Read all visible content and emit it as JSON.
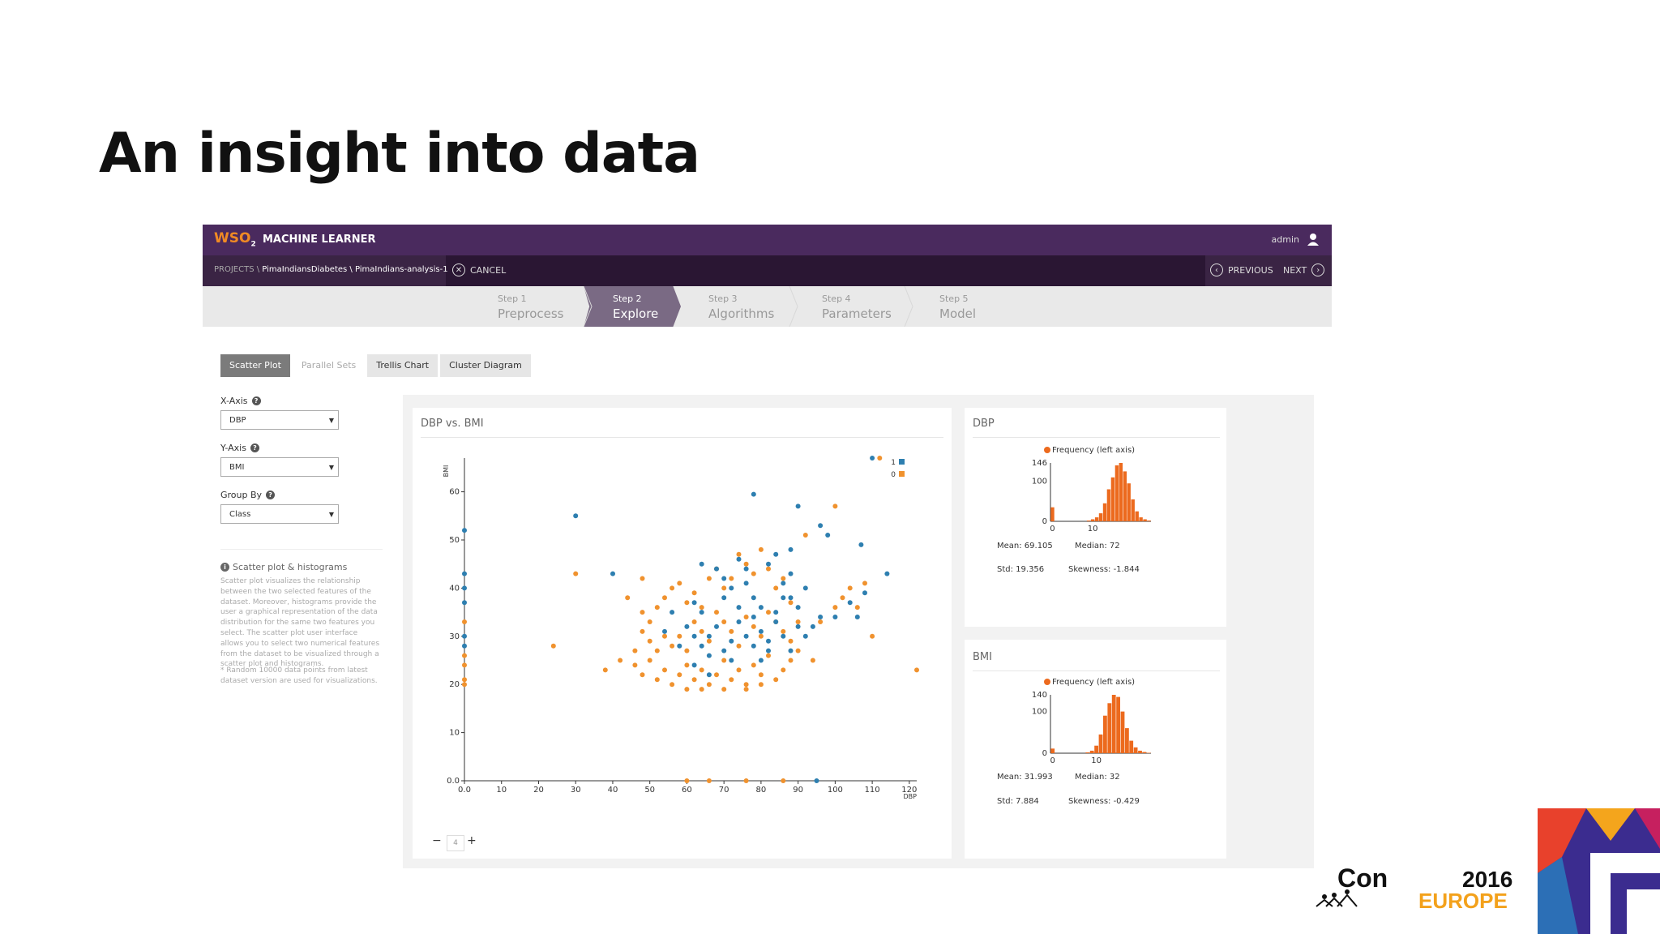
{
  "slide": {
    "title": "An insight into data"
  },
  "app": {
    "logo_text": "WSO",
    "logo_sub": "2",
    "name": "MACHINE LEARNER",
    "user": "admin",
    "breadcrumb_prefix": "PROJECTS \\ ",
    "breadcrumb_path": "PimaIndiansDiabetes \\ PimaIndians-analysis-1",
    "cancel": "CANCEL",
    "previous": "PREVIOUS",
    "next": "NEXT",
    "steps": [
      {
        "num": "Step 1",
        "label": "Preprocess"
      },
      {
        "num": "Step 2",
        "label": "Explore"
      },
      {
        "num": "Step 3",
        "label": "Algorithms"
      },
      {
        "num": "Step 4",
        "label": "Parameters"
      },
      {
        "num": "Step 5",
        "label": "Model"
      }
    ],
    "active_step": 1,
    "tabs": [
      "Scatter Plot",
      "Parallel Sets",
      "Trellis Chart",
      "Cluster Diagram"
    ],
    "x_axis_label": "X-Axis",
    "x_axis_value": "DBP",
    "y_axis_label": "Y-Axis",
    "y_axis_value": "BMI",
    "group_by_label": "Group By",
    "group_by_value": "Class",
    "info_title": "Scatter plot & histograms",
    "info_body": "Scatter plot visualizes the relationship between the two selected features of the dataset. Moreover, histograms provide the user a graphical representation of the data distribution for the same two features you select. The scatter plot user interface allows you to select two numerical features from the dataset to be visualized through a scatter plot and histograms.",
    "info_note": "* Random 10000 data points from latest dataset version are used for visualizations.",
    "zoom_minus": "−",
    "zoom_value": "4",
    "zoom_plus": "+",
    "colors": {
      "class1": "#2e7fb0",
      "class0": "#f0922e",
      "header": "#4a2a5e",
      "hist": "#ec6a1e"
    }
  },
  "chart_data": [
    {
      "type": "scatter",
      "title": "DBP vs. BMI",
      "xlabel": "DBP",
      "ylabel": "BMI",
      "xlim": [
        0,
        122
      ],
      "ylim": [
        0,
        67
      ],
      "xticks": [
        "0.0",
        "10",
        "20",
        "30",
        "40",
        "50",
        "60",
        "70",
        "80",
        "90",
        "100",
        "110",
        "120"
      ],
      "yticks": [
        "0.0",
        "10",
        "20",
        "30",
        "40",
        "50",
        "60"
      ],
      "legend": [
        "1",
        "0"
      ],
      "legend_position": "top-right",
      "series": [
        {
          "name": "1",
          "points": [
            [
              110,
              67
            ],
            [
              30,
              55
            ],
            [
              78,
              59.5
            ],
            [
              90,
              57
            ],
            [
              98,
              51
            ],
            [
              107,
              49
            ],
            [
              114,
              43
            ],
            [
              40,
              43
            ],
            [
              96,
              53
            ],
            [
              0,
              52
            ],
            [
              0,
              43
            ],
            [
              0,
              40
            ],
            [
              0,
              37
            ],
            [
              0,
              30
            ],
            [
              0,
              28
            ],
            [
              95,
              0
            ],
            [
              64,
              45
            ],
            [
              68,
              44
            ],
            [
              70,
              42
            ],
            [
              72,
              40
            ],
            [
              74,
              46
            ],
            [
              76,
              44
            ],
            [
              78,
              38
            ],
            [
              80,
              36
            ],
            [
              82,
              45
            ],
            [
              84,
              33
            ],
            [
              86,
              41
            ],
            [
              88,
              38
            ],
            [
              90,
              36
            ],
            [
              88,
              43
            ],
            [
              92,
              40
            ],
            [
              100,
              34
            ],
            [
              104,
              37
            ],
            [
              106,
              34
            ],
            [
              108,
              39
            ],
            [
              62,
              37
            ],
            [
              64,
              35
            ],
            [
              66,
              30
            ],
            [
              68,
              32
            ],
            [
              70,
              38
            ],
            [
              72,
              29
            ],
            [
              74,
              33
            ],
            [
              76,
              30
            ],
            [
              78,
              34
            ],
            [
              80,
              31
            ],
            [
              82,
              27
            ],
            [
              84,
              35
            ],
            [
              86,
              30
            ],
            [
              88,
              27
            ],
            [
              90,
              32
            ],
            [
              92,
              30
            ],
            [
              94,
              32
            ],
            [
              96,
              34
            ],
            [
              60,
              32
            ],
            [
              58,
              28
            ],
            [
              56,
              35
            ],
            [
              54,
              31
            ],
            [
              62,
              30
            ],
            [
              64,
              28
            ],
            [
              66,
              26
            ],
            [
              70,
              27
            ],
            [
              72,
              25
            ],
            [
              74,
              36
            ],
            [
              76,
              41
            ],
            [
              78,
              28
            ],
            [
              80,
              25
            ],
            [
              82,
              29
            ],
            [
              84,
              47
            ],
            [
              86,
              38
            ],
            [
              88,
              48
            ],
            [
              62,
              24
            ],
            [
              66,
              22
            ]
          ]
        },
        {
          "name": "0",
          "points": [
            [
              112,
              67
            ],
            [
              100,
              57
            ],
            [
              92,
              51
            ],
            [
              110,
              30
            ],
            [
              30,
              43
            ],
            [
              24,
              28
            ],
            [
              122,
              23
            ],
            [
              60,
              0
            ],
            [
              66,
              0
            ],
            [
              76,
              0
            ],
            [
              86,
              0
            ],
            [
              0,
              24
            ],
            [
              0,
              21
            ],
            [
              0,
              20
            ],
            [
              0,
              26
            ],
            [
              0,
              33
            ],
            [
              48,
              42
            ],
            [
              48,
              35
            ],
            [
              50,
              33
            ],
            [
              52,
              36
            ],
            [
              54,
              38
            ],
            [
              56,
              40
            ],
            [
              58,
              41
            ],
            [
              60,
              37
            ],
            [
              62,
              39
            ],
            [
              64,
              36
            ],
            [
              66,
              42
            ],
            [
              68,
              44
            ],
            [
              70,
              40
            ],
            [
              72,
              42
            ],
            [
              74,
              47
            ],
            [
              76,
              45
            ],
            [
              78,
              43
            ],
            [
              80,
              48
            ],
            [
              82,
              44
            ],
            [
              84,
              40
            ],
            [
              86,
              42
            ],
            [
              88,
              37
            ],
            [
              90,
              33
            ],
            [
              48,
              31
            ],
            [
              50,
              29
            ],
            [
              52,
              27
            ],
            [
              54,
              30
            ],
            [
              56,
              28
            ],
            [
              58,
              30
            ],
            [
              60,
              27
            ],
            [
              62,
              33
            ],
            [
              64,
              31
            ],
            [
              66,
              29
            ],
            [
              68,
              35
            ],
            [
              70,
              33
            ],
            [
              72,
              31
            ],
            [
              74,
              28
            ],
            [
              76,
              34
            ],
            [
              78,
              32
            ],
            [
              80,
              30
            ],
            [
              82,
              35
            ],
            [
              84,
              33
            ],
            [
              86,
              31
            ],
            [
              88,
              29
            ],
            [
              90,
              27
            ],
            [
              94,
              25
            ],
            [
              46,
              24
            ],
            [
              48,
              22
            ],
            [
              50,
              25
            ],
            [
              52,
              21
            ],
            [
              54,
              23
            ],
            [
              56,
              20
            ],
            [
              58,
              22
            ],
            [
              60,
              24
            ],
            [
              62,
              21
            ],
            [
              64,
              23
            ],
            [
              66,
              20
            ],
            [
              68,
              22
            ],
            [
              70,
              25
            ],
            [
              72,
              21
            ],
            [
              74,
              23
            ],
            [
              76,
              20
            ],
            [
              78,
              24
            ],
            [
              80,
              22
            ],
            [
              82,
              26
            ],
            [
              84,
              21
            ],
            [
              86,
              23
            ],
            [
              88,
              25
            ],
            [
              96,
              33
            ],
            [
              100,
              36
            ],
            [
              102,
              38
            ],
            [
              104,
              40
            ],
            [
              106,
              36
            ],
            [
              108,
              41
            ],
            [
              38,
              23
            ],
            [
              42,
              25
            ],
            [
              46,
              27
            ],
            [
              44,
              38
            ],
            [
              60,
              19
            ],
            [
              64,
              19
            ],
            [
              70,
              19
            ],
            [
              76,
              19
            ],
            [
              80,
              20
            ]
          ]
        }
      ]
    },
    {
      "type": "bar",
      "title": "DBP",
      "legend": [
        "Frequency (left axis)"
      ],
      "legend_position": "top-left",
      "yticks": [
        "0",
        "100",
        "146"
      ],
      "xticks": [
        "0",
        "10"
      ],
      "values": [
        35,
        0,
        0,
        0,
        0,
        0,
        0,
        0,
        0,
        2,
        5,
        10,
        20,
        45,
        80,
        110,
        140,
        146,
        125,
        95,
        55,
        25,
        10,
        5,
        2
      ],
      "stats": {
        "mean": "Mean: 69.105",
        "median": "Median: 72",
        "std": "Std: 19.356",
        "skewness": "Skewness: -1.844"
      }
    },
    {
      "type": "bar",
      "title": "BMI",
      "legend": [
        "Frequency (left axis)"
      ],
      "legend_position": "top-left",
      "yticks": [
        "0",
        "100",
        "140"
      ],
      "xticks": [
        "0",
        "10"
      ],
      "values": [
        11,
        0,
        0,
        0,
        0,
        0,
        0,
        0,
        2,
        6,
        18,
        45,
        90,
        120,
        140,
        135,
        100,
        60,
        30,
        14,
        6,
        3,
        1
      ],
      "stats": {
        "mean": "Mean: 31.993",
        "median": "Median: 32",
        "std": "Std: 7.884",
        "skewness": "Skewness: -0.429"
      }
    }
  ],
  "conference": {
    "name": "Con",
    "year": "2016",
    "region": "EUROPE"
  }
}
